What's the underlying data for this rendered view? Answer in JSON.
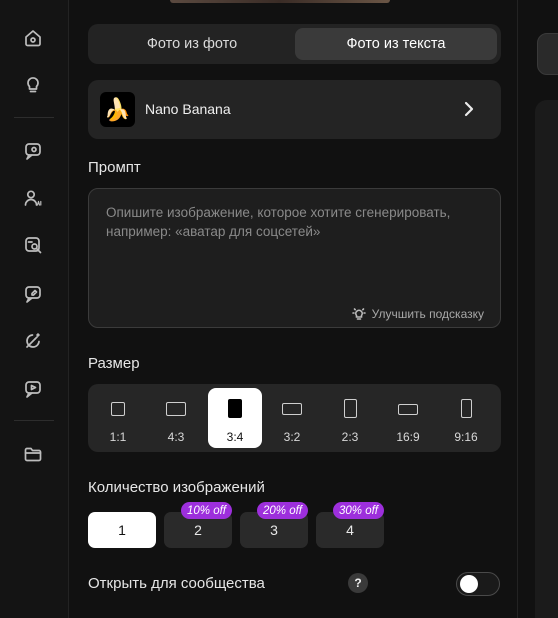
{
  "sidebar": {
    "icons": [
      "home-icon",
      "lightbulb-icon",
      "image-chat-icon",
      "user-ai-icon",
      "image-search-icon",
      "image-edit-icon",
      "magic-icon",
      "video-icon",
      "folder-icon"
    ]
  },
  "mode_tabs": [
    {
      "label": "Фото из фото",
      "active": false
    },
    {
      "label": "Фото из текста",
      "active": true
    }
  ],
  "model": {
    "emoji": "🍌",
    "name": "Nano Banana"
  },
  "prompt": {
    "label": "Промпт",
    "value": "",
    "placeholder": "Опишите изображение, которое хотите сгенерировать, например: «аватар для соцсетей»",
    "improve_label": "Улучшить подсказку"
  },
  "size": {
    "label": "Размер",
    "options": [
      "1:1",
      "4:3",
      "3:4",
      "3:2",
      "2:3",
      "16:9",
      "9:16"
    ],
    "selected": "3:4"
  },
  "count": {
    "label": "Количество изображений",
    "options": [
      {
        "value": "1",
        "badge": ""
      },
      {
        "value": "2",
        "badge": "10% off"
      },
      {
        "value": "3",
        "badge": "20% off"
      },
      {
        "value": "4",
        "badge": "30% off"
      }
    ],
    "selected": "1"
  },
  "community": {
    "label": "Открыть для сообщества",
    "help": "?",
    "enabled": false
  },
  "colors": {
    "accent_badge": "#9d2fdc",
    "selected": "#ffffff",
    "background": "#111111"
  }
}
